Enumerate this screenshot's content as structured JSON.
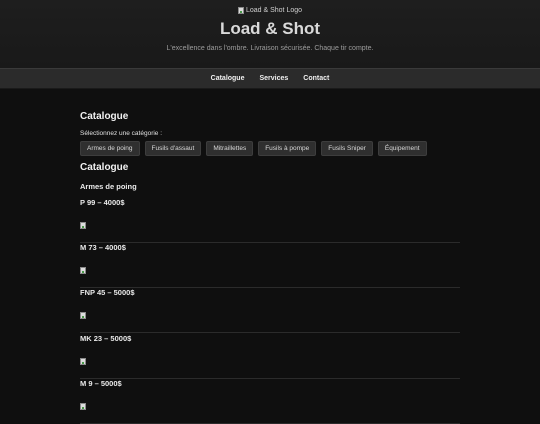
{
  "header": {
    "logo_alt": "Load & Shot Logo",
    "title": "Load & Shot",
    "tagline": "L'excellence dans l'ombre. Livraison sécurisée. Chaque tir compte."
  },
  "nav": [
    "Catalogue",
    "Services",
    "Contact"
  ],
  "catalogue": {
    "title": "Catalogue",
    "select_label": "Sélectionnez une catégorie :",
    "categories": [
      "Armes de poing",
      "Fusils d'assaut",
      "Mitraillettes",
      "Fusils à pompe",
      "Fusils Sniper",
      "Équipement"
    ],
    "section_title": "Catalogue",
    "group_title": "Armes de poing",
    "products": [
      {
        "name": "P 99 – 4000$"
      },
      {
        "name": "M 73 – 4000$"
      },
      {
        "name": "FNP 45 – 5000$"
      },
      {
        "name": "MK 23 – 5000$"
      },
      {
        "name": "M 9 – 5000$"
      }
    ]
  }
}
